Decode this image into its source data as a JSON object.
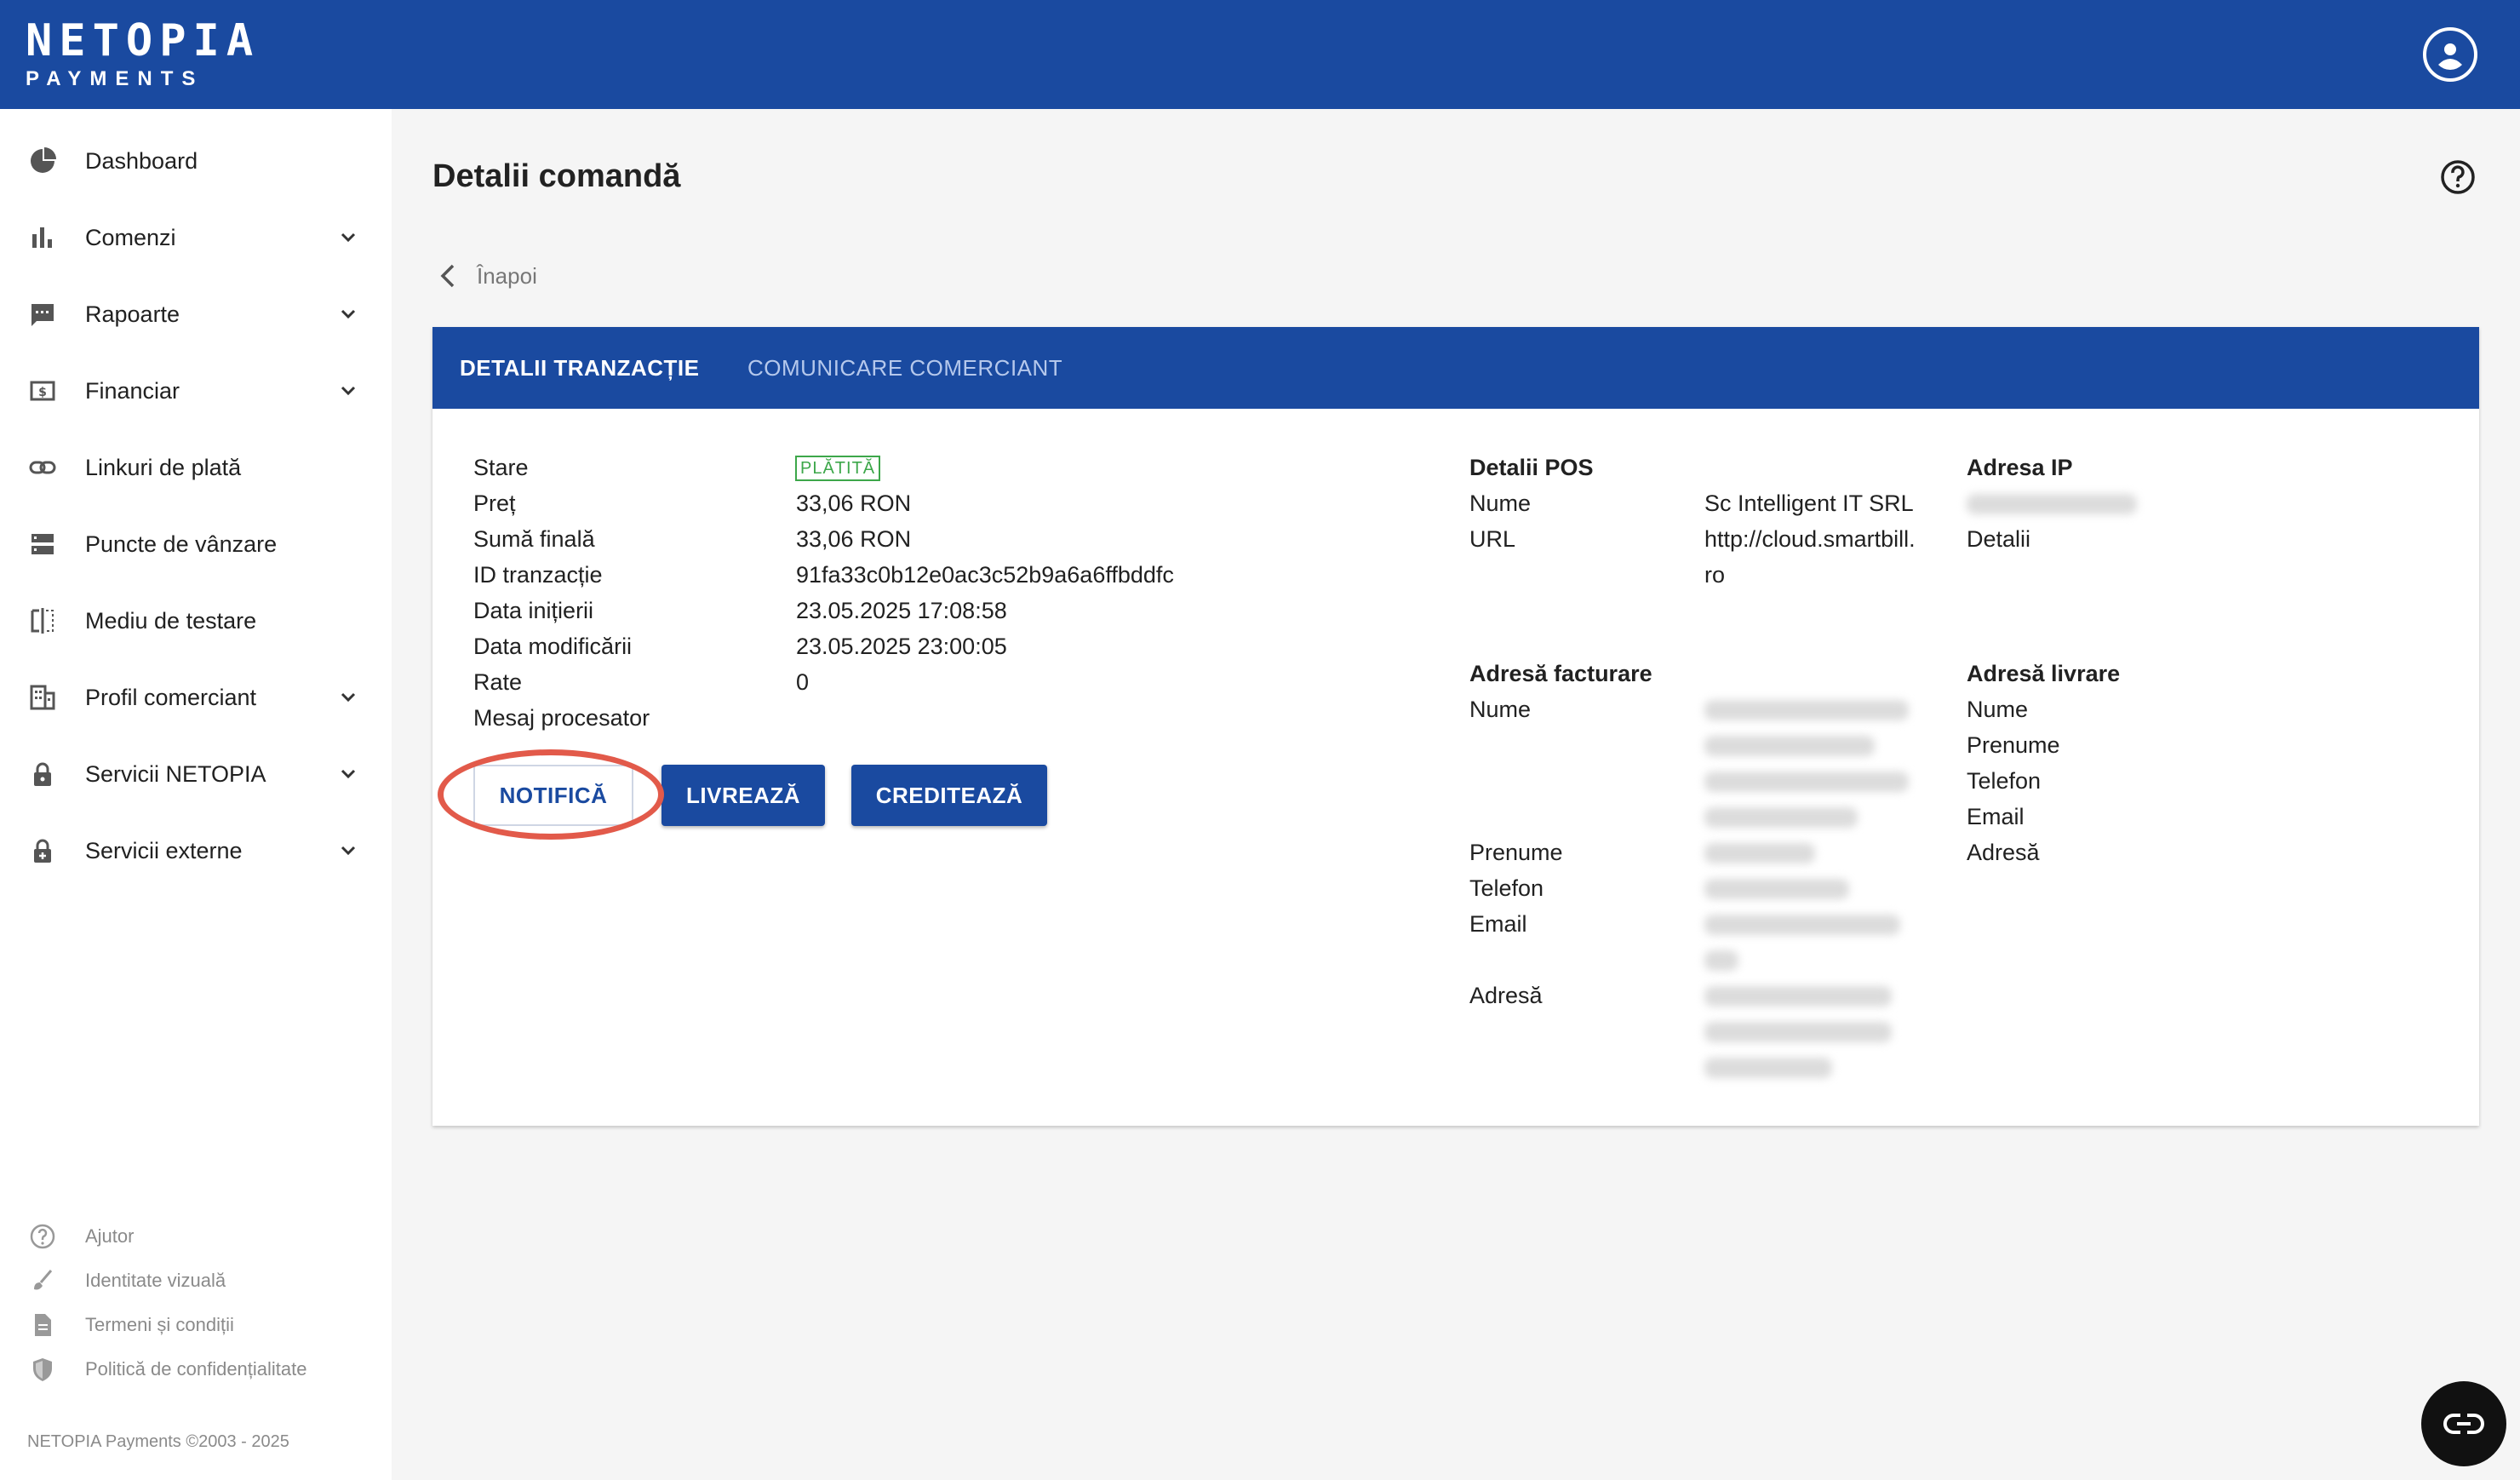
{
  "brand": {
    "logo_main": "NETOPIA",
    "logo_sub": "PAYMENTS"
  },
  "sidebar": {
    "items": [
      {
        "label": "Dashboard",
        "icon": "pie-chart-icon",
        "expandable": false
      },
      {
        "label": "Comenzi",
        "icon": "bar-chart-icon",
        "expandable": true
      },
      {
        "label": "Rapoarte",
        "icon": "message-icon",
        "expandable": true
      },
      {
        "label": "Financiar",
        "icon": "money-icon",
        "expandable": true
      },
      {
        "label": "Linkuri de plată",
        "icon": "link-icon",
        "expandable": false
      },
      {
        "label": "Puncte de vânzare",
        "icon": "storage-icon",
        "expandable": false
      },
      {
        "label": "Mediu de testare",
        "icon": "compare-icon",
        "expandable": false
      },
      {
        "label": "Profil comerciant",
        "icon": "building-icon",
        "expandable": true
      },
      {
        "label": "Servicii NETOPIA",
        "icon": "lock-icon",
        "expandable": true
      },
      {
        "label": "Servicii externe",
        "icon": "lock-plus-icon",
        "expandable": true
      }
    ],
    "footer": [
      {
        "label": "Ajutor",
        "icon": "help-icon"
      },
      {
        "label": "Identitate vizuală",
        "icon": "brush-icon"
      },
      {
        "label": "Termeni și condiții",
        "icon": "document-icon"
      },
      {
        "label": "Politică de confidențialitate",
        "icon": "shield-icon"
      }
    ],
    "copyright": "NETOPIA Payments ©2003 - 2025"
  },
  "main": {
    "title": "Detalii comandă",
    "back_label": "Înapoi",
    "tabs": [
      {
        "label": "DETALII TRANZACȚIE",
        "active": true
      },
      {
        "label": "COMUNICARE COMERCIANT",
        "active": false
      }
    ],
    "transaction": {
      "stare_label": "Stare",
      "stare_value": "PLĂTITĂ",
      "pret_label": "Preț",
      "pret_value": "33,06 RON",
      "suma_label": "Sumă finală",
      "suma_value": "33,06 RON",
      "id_label": "ID tranzacție",
      "id_value": "91fa33c0b12e0ac3c52b9a6a6ffbddfc",
      "data_init_label": "Data inițierii",
      "data_init_value": "23.05.2025 17:08:58",
      "data_mod_label": "Data modificării",
      "data_mod_value": "23.05.2025 23:00:05",
      "rate_label": "Rate",
      "rate_value": "0",
      "mesaj_label": "Mesaj procesator"
    },
    "buttons": {
      "notifica": "NOTIFICĂ",
      "livreaza": "LIVREAZĂ",
      "crediteaza": "CREDITEAZĂ"
    },
    "pos": {
      "heading": "Detalii POS",
      "nume_label": "Nume",
      "nume_value": "Sc Intelligent IT SRL",
      "url_label": "URL",
      "url_value_line1": "http://cloud.smartbill.",
      "url_value_line2": "ro"
    },
    "ip": {
      "heading": "Adresa IP",
      "details_label": "Detalii"
    },
    "billing": {
      "heading": "Adresă facturare",
      "nume_label": "Nume",
      "prenume_label": "Prenume",
      "telefon_label": "Telefon",
      "email_label": "Email",
      "adresa_label": "Adresă"
    },
    "delivery": {
      "heading": "Adresă livrare",
      "nume_label": "Nume",
      "prenume_label": "Prenume",
      "telefon_label": "Telefon",
      "email_label": "Email",
      "adresa_label": "Adresă"
    }
  },
  "colors": {
    "brand_blue": "#1a4aa0",
    "paid_green": "#3da74a",
    "highlight_red": "#e25a4a"
  }
}
